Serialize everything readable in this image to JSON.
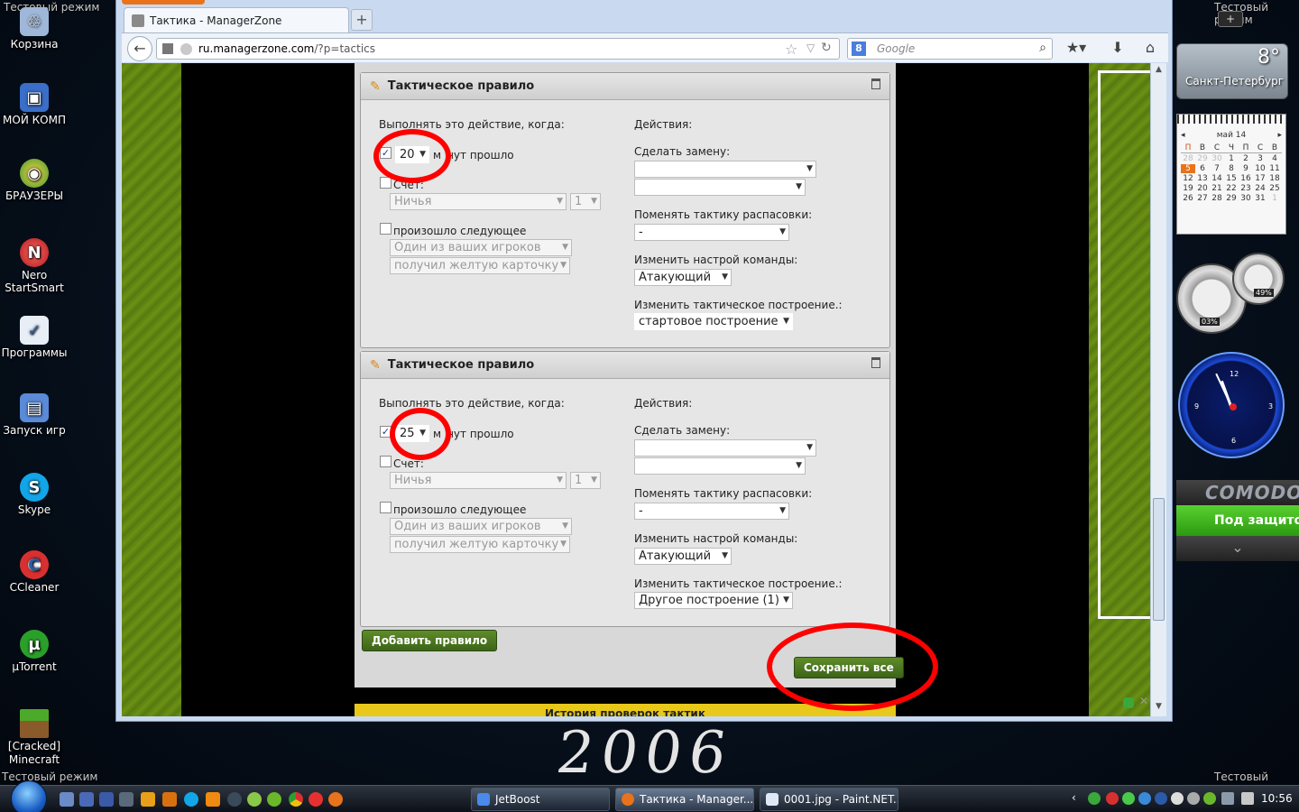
{
  "desktop": {
    "icons": [
      {
        "label": "Корзина"
      },
      {
        "label": "МОЙ КОМП"
      },
      {
        "label": "БРАУЗЕРЫ"
      },
      {
        "label": "Nero StartSmart"
      },
      {
        "label": "Программы"
      },
      {
        "label": "Запуск игр"
      },
      {
        "label": "Skype"
      },
      {
        "label": "CCleaner"
      },
      {
        "label": "µTorrent"
      },
      {
        "label": "[Cracked] Minecraft"
      }
    ],
    "test_mode_label": "Тестовый режим",
    "wallpaper_text": "2006"
  },
  "browser": {
    "tab_title": "Тактика - ManagerZone",
    "new_tab_label": "+",
    "url_host": "ru.managerzone.com",
    "url_path": "/?p=tactics",
    "search_placeholder": "Google",
    "search_engine_letter": "8"
  },
  "tactics": {
    "rules": [
      {
        "header": "Тактическое правило",
        "condition_title": "Выполнять это действие, когда:",
        "minutes_value": "20",
        "minutes_suffix": "нут прошло",
        "minutes_prefix": "м",
        "minutes_checked": true,
        "score_label": "Счет:",
        "score_checked": false,
        "score_select": "Ничья",
        "score_goal_select": "1",
        "event_label": "произошло следующее",
        "event_checked": false,
        "event_player_select": "Один из ваших игроков",
        "event_type_select": "получил желтую карточку",
        "actions_title": "Действия:",
        "substitution_label": "Сделать замену:",
        "sub_out_select": "",
        "sub_in_select": "",
        "marking_label": "Поменять тактику распасовки:",
        "marking_select": "-",
        "mood_label": "Изменить настрой команды:",
        "mood_select": "Атакующий",
        "formation_label": "Изменить тактическое построение.:",
        "formation_select": "стартовое построение"
      },
      {
        "header": "Тактическое правило",
        "condition_title": "Выполнять это действие, когда:",
        "minutes_value": "25",
        "minutes_suffix": "нут прошло",
        "minutes_prefix": "м",
        "minutes_checked": true,
        "score_label": "Счет:",
        "score_checked": false,
        "score_select": "Ничья",
        "score_goal_select": "1",
        "event_label": "произошло следующее",
        "event_checked": false,
        "event_player_select": "Один из ваших игроков",
        "event_type_select": "получил желтую карточку",
        "actions_title": "Действия:",
        "substitution_label": "Сделать замену:",
        "sub_out_select": "",
        "sub_in_select": "",
        "marking_label": "Поменять тактику распасовки:",
        "marking_select": "-",
        "mood_label": "Изменить настрой команды:",
        "mood_select": "Атакующий",
        "formation_label": "Изменить тактическое построение.:",
        "formation_select": "Другое построение (1)"
      }
    ],
    "add_rule_label": "Добавить правило",
    "save_all_label": "Сохранить все",
    "history_label": "История проверок тактик"
  },
  "gadgets": {
    "weather_temp": "8°",
    "weather_city": "Санкт-Петербург",
    "calendar_month": "май 14",
    "calendar_weekdays": [
      "П",
      "В",
      "С",
      "Ч",
      "П",
      "С",
      "В"
    ],
    "calendar_today": "5",
    "cpu_percent": "03%",
    "ram_percent": "49%",
    "comodo_brand": "COMODO",
    "comodo_status": "Под защитой",
    "sidebar_add": "+"
  },
  "taskbar": {
    "tasks": [
      {
        "label": "JetBoost"
      },
      {
        "label": "Тактика - Manager..."
      },
      {
        "label": "0001.jpg - Paint.NET..."
      }
    ],
    "time": "10:56"
  }
}
